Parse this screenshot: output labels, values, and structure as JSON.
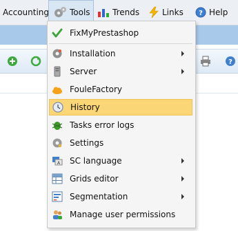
{
  "menubar": {
    "items": [
      {
        "label": "Accounting",
        "icon": "none"
      },
      {
        "label": "Tools",
        "icon": "gears-icon"
      },
      {
        "label": "Trends",
        "icon": "bar-chart-icon"
      },
      {
        "label": "Links",
        "icon": "lightning-icon"
      },
      {
        "label": "Help",
        "icon": "help-icon"
      }
    ]
  },
  "tools_menu": {
    "items": [
      {
        "label": "FixMyPrestashop",
        "icon": "checkmark-icon",
        "submenu": false
      },
      {
        "label": "Installation",
        "icon": "gear-icon",
        "submenu": true
      },
      {
        "label": "Server",
        "icon": "server-icon",
        "submenu": true
      },
      {
        "label": "FouleFactory",
        "icon": "cloud-icon",
        "submenu": false
      },
      {
        "label": "History",
        "icon": "clock-icon",
        "submenu": false,
        "highlighted": true
      },
      {
        "label": "Tasks error logs",
        "icon": "bug-icon",
        "submenu": false
      },
      {
        "label": "Settings",
        "icon": "gear-icon",
        "submenu": false
      },
      {
        "label": "SC language",
        "icon": "language-icon",
        "submenu": true
      },
      {
        "label": "Grids editor",
        "icon": "grid-icon",
        "submenu": true
      },
      {
        "label": "Segmentation",
        "icon": "segment-icon",
        "submenu": true
      },
      {
        "label": "Manage user permissions",
        "icon": "users-icon",
        "submenu": false
      }
    ]
  },
  "colors": {
    "highlight": "#fbd676",
    "band": "#a9c9ea",
    "menu_bg": "#f5f5f5"
  }
}
